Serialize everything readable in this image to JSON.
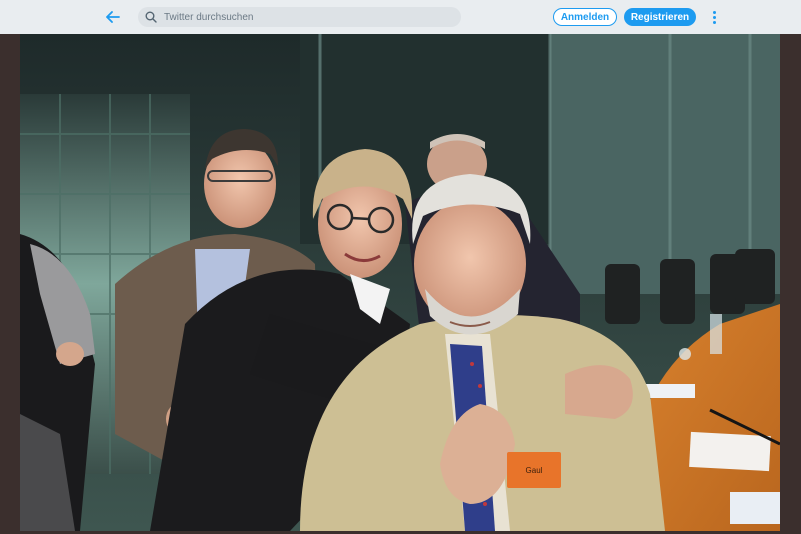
{
  "header": {
    "back_icon": "arrow-left-icon",
    "search": {
      "placeholder": "Twitter durchsuchen",
      "icon": "search-icon"
    },
    "login_label": "Anmelden",
    "register_label": "Registrieren",
    "more_icon": "more-vertical-icon"
  },
  "photo": {
    "name_badge_text": "Gaul"
  },
  "colors": {
    "accent": "#1d9bf0",
    "topbar_bg": "#e9edf0",
    "frame_bg": "#3b2f2d"
  }
}
